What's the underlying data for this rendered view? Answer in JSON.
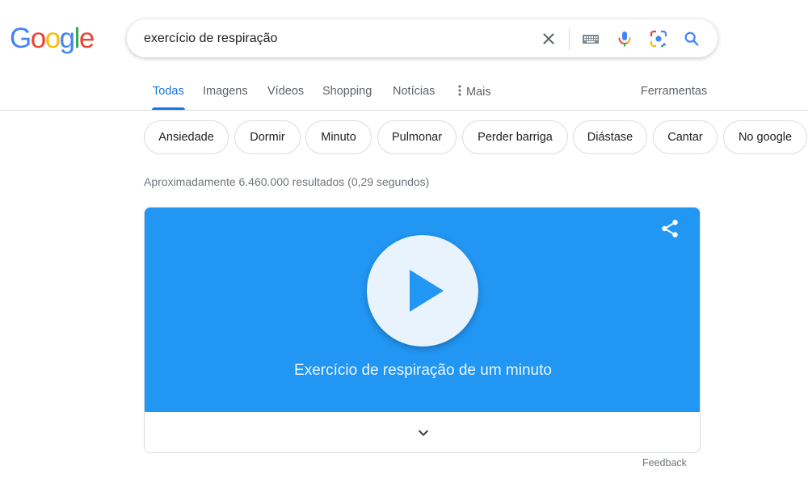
{
  "logo": {
    "letters": [
      "G",
      "o",
      "o",
      "g",
      "l",
      "e"
    ],
    "colors": [
      "#4285f4",
      "#ea4335",
      "#fbbc05",
      "#4285f4",
      "#34a853",
      "#ea4335"
    ]
  },
  "search": {
    "query": "exercício de respiração",
    "icons": [
      "clear-icon",
      "keyboard-icon",
      "mic-icon",
      "lens-icon",
      "search-icon"
    ]
  },
  "tabs": [
    {
      "label": "Todas",
      "active": true
    },
    {
      "label": "Imagens"
    },
    {
      "label": "Vídeos"
    },
    {
      "label": "Shopping"
    },
    {
      "label": "Notícias"
    },
    {
      "label": "Mais",
      "icon": "more-vert-icon"
    }
  ],
  "tools_label": "Ferramentas",
  "chips": [
    "Ansiedade",
    "Dormir",
    "Minuto",
    "Pulmonar",
    "Perder barriga",
    "Diástase",
    "Cantar",
    "No google"
  ],
  "result_stats": "Aproximadamente 6.460.000 resultados (0,29 segundos)",
  "card": {
    "title": "Exercício de respiração de um minuto",
    "background": "#2196f3",
    "icons": [
      "share-icon",
      "play-icon",
      "chevron-down-icon"
    ]
  },
  "feedback_label": "Feedback",
  "colors": {
    "accent": "#1a73e8",
    "text_secondary": "#5f6368"
  }
}
